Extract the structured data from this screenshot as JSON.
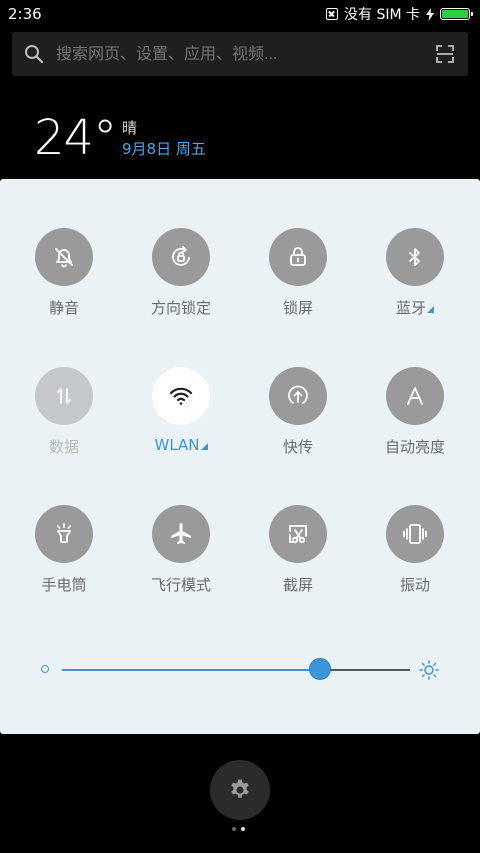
{
  "status_bar": {
    "time": "2:36",
    "sim_status": "没有 SIM 卡",
    "battery_level": 1.0
  },
  "search": {
    "placeholder": "搜索网页、设置、应用、视频..."
  },
  "weather": {
    "temperature": "24°",
    "condition": "晴",
    "date": "9月8日 周五"
  },
  "toggles": [
    {
      "label": "静音",
      "icon": "silent-bell-icon",
      "state": "off"
    },
    {
      "label": "方向锁定",
      "icon": "rotation-lock-icon",
      "state": "off"
    },
    {
      "label": "锁屏",
      "icon": "lock-icon",
      "state": "off"
    },
    {
      "label": "蓝牙",
      "icon": "bluetooth-icon",
      "state": "off",
      "expandable": true
    },
    {
      "label": "数据",
      "icon": "mobile-data-icon",
      "state": "disabled"
    },
    {
      "label": "WLAN",
      "icon": "wifi-icon",
      "state": "on",
      "expandable": true
    },
    {
      "label": "快传",
      "icon": "quick-transfer-icon",
      "state": "off"
    },
    {
      "label": "自动亮度",
      "icon": "auto-brightness-icon",
      "state": "off"
    },
    {
      "label": "手电筒",
      "icon": "flashlight-icon",
      "state": "off"
    },
    {
      "label": "飞行模式",
      "icon": "airplane-icon",
      "state": "off"
    },
    {
      "label": "截屏",
      "icon": "screenshot-icon",
      "state": "off"
    },
    {
      "label": "振动",
      "icon": "vibrate-icon",
      "state": "off"
    }
  ],
  "brightness": {
    "level": 0.74
  },
  "colors": {
    "accent": "#3d95d8",
    "panel_bg": "#eaf2f5",
    "tile_off": "#9a9a9a",
    "tile_disabled": "#c5c9cb",
    "tile_on": "#ffffff",
    "battery": "#2bd03e"
  },
  "bottom": {
    "settings_icon": "gear-icon",
    "page_count": 2,
    "current_page": 2
  }
}
